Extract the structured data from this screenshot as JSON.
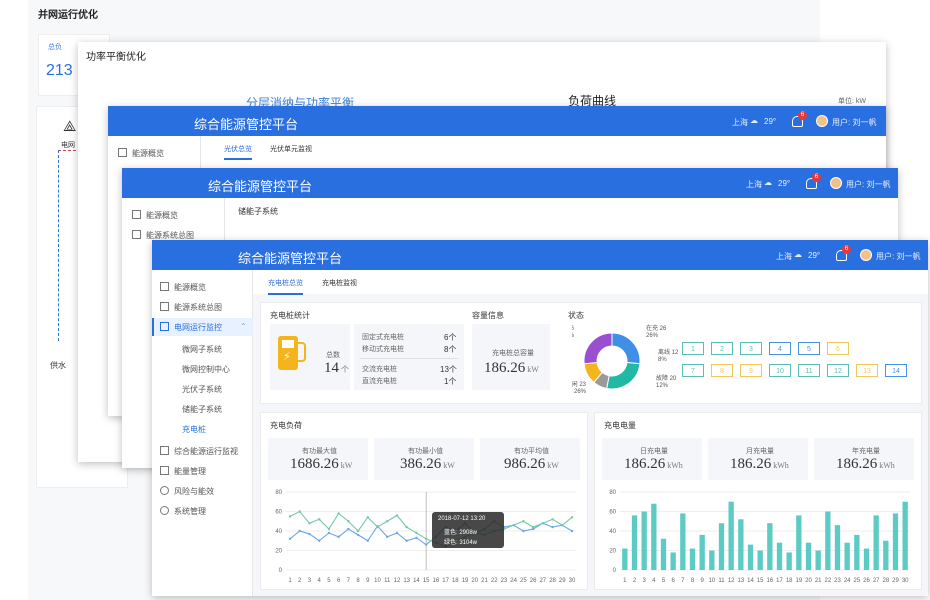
{
  "back": {
    "title": "并网运行优化",
    "stat_label": "总负",
    "stat_value": "213",
    "grid_label": "电网",
    "supply_label": "供水"
  },
  "mid": {
    "title": "功率平衡优化",
    "panel_title": "分层消纳与功率平衡",
    "curve_title": "负荷曲线",
    "unit": "单位: kW"
  },
  "app_title": "综合能源管控平台",
  "header": {
    "city": "上海",
    "temp": "29°",
    "notif": "6",
    "user": "用户: 刘一帆"
  },
  "win1": {
    "sidebar": [
      "能源概览"
    ],
    "tabs": [
      "光伏总览",
      "光伏单元监视"
    ]
  },
  "win2": {
    "sidebar": [
      "能源概览",
      "能源系统总图"
    ],
    "breadcrumb": "储能子系统"
  },
  "win3": {
    "tabs": [
      "充电桩总览",
      "充电桩监视"
    ],
    "sidebar": {
      "top": [
        "能源概览",
        "能源系统总图"
      ],
      "group": "电网运行监控",
      "subs": [
        "微网子系统",
        "微网控制中心",
        "光伏子系统",
        "储能子系统",
        "充电桩"
      ],
      "bottom": [
        "综合能源运行监视",
        "能量管理",
        "风险与能效",
        "系统管理"
      ]
    },
    "stats": {
      "title": "充电桩统计",
      "total_label": "总数",
      "total_value": "14",
      "total_unit": "个",
      "rows_top": [
        {
          "label": "固定式充电桩",
          "value": "6个"
        },
        {
          "label": "移动式充电桩",
          "value": "8个"
        }
      ],
      "rows_bottom": [
        {
          "label": "交流充电桩",
          "value": "13个"
        },
        {
          "label": "直流充电桩",
          "value": "1个"
        }
      ]
    },
    "capacity": {
      "title": "容量信息",
      "label": "充电桩总容量",
      "value": "186.26",
      "unit": "kW"
    },
    "status": {
      "title": "状态",
      "legend": [
        {
          "name": "充满",
          "value": "26",
          "pct": "26%",
          "color": "#3f8ee8"
        },
        {
          "name": "在充",
          "value": "26",
          "pct": "26%",
          "color": "#22b8a6"
        },
        {
          "name": "离线",
          "value": "12",
          "pct": "8%",
          "color": "#9a9a9a"
        },
        {
          "name": "故障",
          "value": "20",
          "pct": "12%",
          "color": "#f5b41b"
        },
        {
          "name": "空闲",
          "value": "23",
          "pct": "26%",
          "color": "#9a4fd0"
        }
      ],
      "boxes": [
        {
          "n": "1",
          "c": "#5bbdb3"
        },
        {
          "n": "2",
          "c": "#5bbdb3"
        },
        {
          "n": "3",
          "c": "#5bbdb3"
        },
        {
          "n": "4",
          "c": "#4a90e2"
        },
        {
          "n": "5",
          "c": "#4a90e2"
        },
        {
          "n": "6",
          "c": "#f0c75a"
        },
        {
          "n": "7",
          "c": "#5bbdb3"
        },
        {
          "n": "8",
          "c": "#f0c75a"
        },
        {
          "n": "9",
          "c": "#f0c75a"
        },
        {
          "n": "10",
          "c": "#5bbdb3"
        },
        {
          "n": "11",
          "c": "#5bbdb3"
        },
        {
          "n": "12",
          "c": "#5bbdb3"
        },
        {
          "n": "13",
          "c": "#f0c75a"
        },
        {
          "n": "14",
          "c": "#4a90e2"
        }
      ]
    },
    "load": {
      "title": "充电负荷",
      "kpis": [
        {
          "label": "有功最大值",
          "value": "1686.26",
          "unit": "kW"
        },
        {
          "label": "有功最小值",
          "value": "386.26",
          "unit": "kW"
        },
        {
          "label": "有功平均值",
          "value": "986.26",
          "unit": "kW"
        }
      ],
      "tooltip": {
        "date": "2018-07-12 13:20",
        "l1": "蓝色: 2908w",
        "l2": "绿色: 3104w"
      }
    },
    "energy": {
      "title": "充电电量",
      "kpis": [
        {
          "label": "日充电量",
          "value": "186.26",
          "unit": "kWh"
        },
        {
          "label": "月充电量",
          "value": "186.26",
          "unit": "kWh"
        },
        {
          "label": "年充电量",
          "value": "186.26",
          "unit": "kWh"
        }
      ]
    }
  },
  "chart_data": [
    {
      "type": "line",
      "title": "充电负荷",
      "x": [
        1,
        2,
        3,
        4,
        5,
        6,
        7,
        8,
        9,
        10,
        11,
        12,
        13,
        14,
        15,
        16,
        17,
        18,
        19,
        20,
        21,
        22,
        23,
        24,
        25,
        26,
        27,
        28,
        29,
        30
      ],
      "ylim": [
        0,
        80
      ],
      "yticks": [
        0,
        20,
        40,
        60,
        80
      ],
      "series": [
        {
          "color": "#6aa7e8",
          "values": [
            32,
            40,
            37,
            30,
            38,
            34,
            42,
            36,
            30,
            45,
            34,
            38,
            30,
            33,
            26,
            34,
            44,
            40,
            48,
            38,
            42,
            50,
            44,
            46,
            40,
            42,
            48,
            44,
            46,
            40
          ]
        },
        {
          "color": "#74c9a3",
          "values": [
            55,
            60,
            48,
            52,
            42,
            58,
            50,
            40,
            54,
            44,
            50,
            56,
            44,
            38,
            32,
            28,
            24,
            30,
            34,
            38,
            36,
            40,
            42,
            46,
            50,
            44,
            48,
            52,
            46,
            54
          ]
        }
      ]
    },
    {
      "type": "bar",
      "title": "充电电量",
      "categories": [
        1,
        2,
        3,
        4,
        5,
        6,
        7,
        8,
        9,
        10,
        11,
        12,
        13,
        14,
        15,
        16,
        17,
        18,
        19,
        20,
        21,
        22,
        23,
        24,
        25,
        26,
        27,
        28,
        29,
        30
      ],
      "ylim": [
        0,
        80
      ],
      "yticks": [
        0,
        20,
        40,
        60,
        80
      ],
      "values": [
        22,
        56,
        60,
        68,
        32,
        18,
        58,
        22,
        36,
        20,
        48,
        70,
        52,
        26,
        20,
        48,
        28,
        18,
        56,
        28,
        20,
        60,
        46,
        28,
        36,
        22,
        56,
        30,
        58,
        70
      ]
    }
  ]
}
